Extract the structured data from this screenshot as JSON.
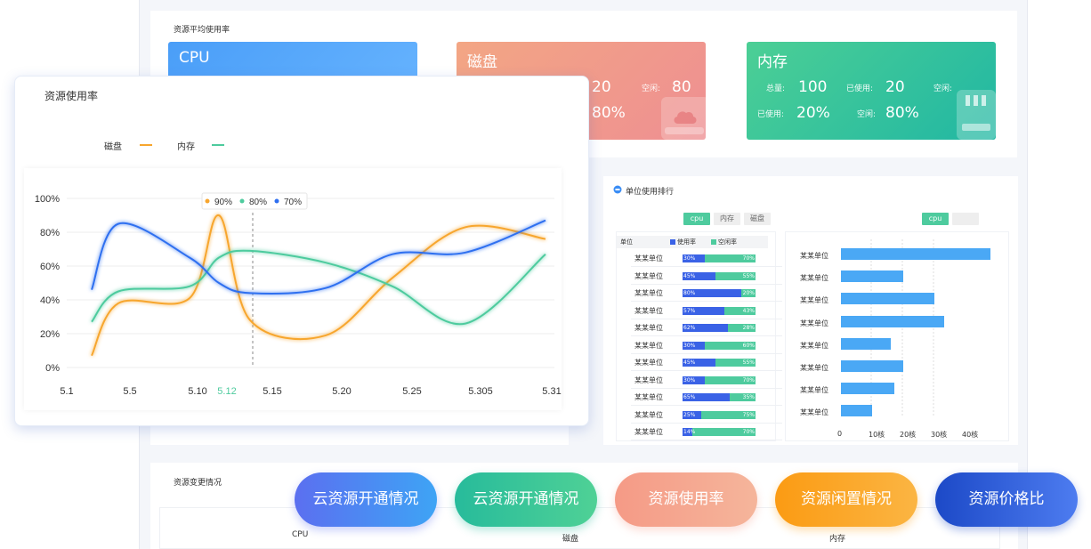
{
  "dashboard": {
    "avg_usage_title": "资源平均使用率",
    "cards": [
      {
        "title": "CPU",
        "color_from": "#4a9ef8",
        "color_to": "#6ab6ff"
      },
      {
        "title": "磁盘",
        "val1": "20",
        "free_label": "空闲:",
        "free_val": "80",
        "val2": "80%",
        "color_from": "#f3a684",
        "color_to": "#ee8f92"
      },
      {
        "title": "内存",
        "total_label": "总量:",
        "total_val": "100",
        "used_label": "已使用:",
        "used_val": "20",
        "free_label": "空闲:",
        "used_pct_label": "已使用:",
        "used_pct": "20%",
        "free_pct_label": "空闲:",
        "free_pct": "80%",
        "color_from": "#4ccf95",
        "color_to": "#21b7a3"
      }
    ],
    "ranking": {
      "title": "单位使用排行",
      "tabs": [
        "cpu",
        "内存",
        "磁盘"
      ],
      "right_tab": "cpu",
      "header": {
        "unit": "单位",
        "used": "使用率",
        "free": "空闲率"
      },
      "rows": [
        {
          "name": "某某单位",
          "used": 30,
          "used_label": "30%",
          "free_label": "70%"
        },
        {
          "name": "某某单位",
          "used": 45,
          "used_label": "45%",
          "free_label": "55%"
        },
        {
          "name": "某某单位",
          "used": 80,
          "used_label": "80%",
          "free_label": "20%"
        },
        {
          "name": "某某单位",
          "used": 57,
          "used_label": "57%",
          "free_label": "43%"
        },
        {
          "name": "某某单位",
          "used": 62,
          "used_label": "62%",
          "free_label": "28%"
        },
        {
          "name": "某某单位",
          "used": 30,
          "used_label": "30%",
          "free_label": "60%"
        },
        {
          "name": "某某单位",
          "used": 45,
          "used_label": "45%",
          "free_label": "55%"
        },
        {
          "name": "某某单位",
          "used": 30,
          "used_label": "30%",
          "free_label": "70%"
        },
        {
          "name": "某某单位",
          "used": 65,
          "used_label": "65%",
          "free_label": "35%"
        },
        {
          "name": "某某单位",
          "used": 25,
          "used_label": "25%",
          "free_label": "75%"
        },
        {
          "name": "某某单位",
          "used": 14,
          "used_label": "14%",
          "free_label": "70%"
        }
      ],
      "hbars": [
        {
          "name": "某某单位",
          "value": 48
        },
        {
          "name": "某某单位",
          "value": 20
        },
        {
          "name": "某某单位",
          "value": 30
        },
        {
          "name": "某某单位",
          "value": 33
        },
        {
          "name": "某某单位",
          "value": 16
        },
        {
          "name": "某某单位",
          "value": 20
        },
        {
          "name": "某某单位",
          "value": 17
        },
        {
          "name": "某某单位",
          "value": 10
        }
      ],
      "hbar_ticks": [
        "0",
        "10核",
        "20核",
        "30核",
        "40核"
      ]
    },
    "change": {
      "title": "资源变更情况",
      "cols": [
        "CPU",
        "磁盘",
        "内存"
      ]
    }
  },
  "chart_card": {
    "title": "资源使用率",
    "legend": [
      {
        "name": "磁盘",
        "color": "#f7a62e"
      },
      {
        "name": "内存",
        "color": "#4ecb9e"
      }
    ],
    "tooltip": [
      {
        "label": "90%",
        "color": "#f7a62e"
      },
      {
        "label": "80%",
        "color": "#4ecb9e"
      },
      {
        "label": "70%",
        "color": "#2f6ff0"
      }
    ]
  },
  "chart_data": {
    "type": "line",
    "x": [
      "5.1",
      "5.5",
      "5.10",
      "5.12",
      "5.15",
      "5.20",
      "5.25",
      "5.305",
      "5.31"
    ],
    "highlight_x": "5.12",
    "ylim": [
      0,
      100
    ],
    "yticks": [
      "100%",
      "80%",
      "60%",
      "40%",
      "20%",
      "0%"
    ],
    "series": [
      {
        "name": "磁盘",
        "color": "#f7a62e",
        "values": [
          7,
          38,
          41,
          90,
          28,
          19,
          53,
          83,
          76
        ]
      },
      {
        "name": "内存",
        "color": "#4ecb9e",
        "values": [
          27,
          45,
          48,
          65,
          69,
          62,
          48,
          26,
          67
        ]
      },
      {
        "color": "#2f6ff0",
        "values": [
          46,
          85,
          65,
          50,
          44,
          47,
          67,
          68,
          87
        ]
      }
    ]
  },
  "nav": {
    "pills": [
      {
        "label": "云资源开通情况",
        "from": "#5b6ff0",
        "to": "#3ea4f5"
      },
      {
        "label": "云资源开通情况",
        "from": "#27bb9b",
        "to": "#4fd196"
      },
      {
        "label": "资源使用率",
        "from": "#f59a86",
        "to": "#f5b59b"
      },
      {
        "label": "资源闲置情况",
        "from": "#fb9b13",
        "to": "#fbb543"
      },
      {
        "label": "资源价格比",
        "from": "#1c49c7",
        "to": "#4d7cf0"
      }
    ]
  }
}
